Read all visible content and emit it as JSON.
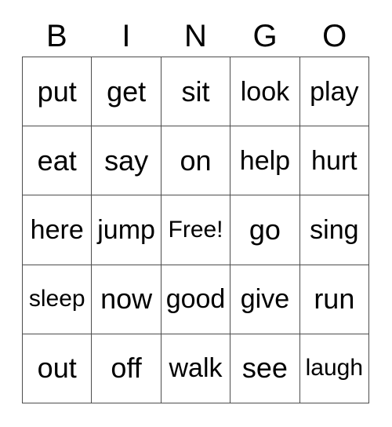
{
  "card": {
    "title_letters": [
      "B",
      "I",
      "N",
      "G",
      "O"
    ],
    "free_space_label": "Free!",
    "colors": {
      "background": "#ffffff",
      "border": "#4d4d4d",
      "text": "#000000"
    },
    "rows": [
      [
        "put",
        "get",
        "sit",
        "look",
        "play"
      ],
      [
        "eat",
        "say",
        "on",
        "help",
        "hurt"
      ],
      [
        "here",
        "jump",
        "Free!",
        "go",
        "sing"
      ],
      [
        "sleep",
        "now",
        "good",
        "give",
        "run"
      ],
      [
        "out",
        "off",
        "walk",
        "see",
        "laugh"
      ]
    ]
  }
}
